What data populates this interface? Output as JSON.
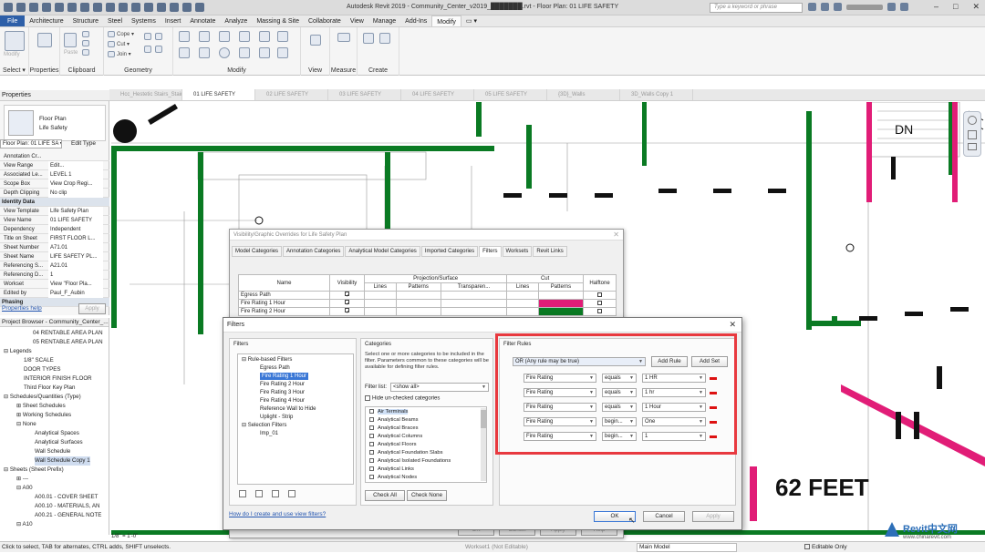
{
  "titlebar": {
    "title": "Autodesk Revit 2019 - Community_Center_v2019_███████.rvt - Floor Plan: 01 LIFE SAFETY",
    "search_placeholder": "Type a keyword or phrase",
    "window_controls": [
      "–",
      "□",
      "✕"
    ]
  },
  "tabs": [
    "File",
    "Architecture",
    "Structure",
    "Steel",
    "Systems",
    "Insert",
    "Annotate",
    "Analyze",
    "Massing & Site",
    "Collaborate",
    "View",
    "Manage",
    "Add-Ins",
    "Modify",
    "▭ ▾"
  ],
  "ribbon": {
    "modify_label": "Modify",
    "select_label": "Select ▾",
    "properties_label": "Properties",
    "clipboard_label": "Clipboard",
    "paste_label": "Paste",
    "cope": "Cope ▾",
    "cut": "Cut ▾",
    "join": "Join ▾",
    "geometry_label": "Geometry",
    "modify_group_label": "Modify",
    "view_label": "View",
    "measure_label": "Measure",
    "create_label": "Create"
  },
  "doc_tabs": [
    "Hcc_Hestetic Stairs_Stair...",
    "01 LIFE SAFETY",
    "02 LIFE SAFETY",
    "03 LIFE SAFETY",
    "04 LIFE SAFETY",
    "05 LIFE SAFETY",
    "{3D}_Walls",
    "3D_Walls Copy 1"
  ],
  "properties": {
    "title": "Properties",
    "type_line1": "Floor Plan",
    "type_line2": "Life Safety",
    "selector": "Floor Plan: 01 LIFE SA ▾",
    "edit_type": "Edit Type",
    "rows": [
      {
        "k": "Annotation Cr...",
        "v": ""
      },
      {
        "k": "View Range",
        "v": "Edit..."
      },
      {
        "k": "Associated Le...",
        "v": "LEVEL 1"
      },
      {
        "k": "Scope Box",
        "v": "View Crop Regi..."
      },
      {
        "k": "Depth Clipping",
        "v": "No clip"
      },
      {
        "k": "Identity Data",
        "v": "",
        "head": true
      },
      {
        "k": "View Template",
        "v": "Life Safety Plan"
      },
      {
        "k": "View Name",
        "v": "01 LIFE SAFETY"
      },
      {
        "k": "Dependency",
        "v": "Independent"
      },
      {
        "k": "Title on Sheet",
        "v": "FIRST FLOOR L..."
      },
      {
        "k": "Sheet Number",
        "v": "A71.01"
      },
      {
        "k": "Sheet Name",
        "v": "LIFE SAFETY PL..."
      },
      {
        "k": "Referencing S...",
        "v": "A21.01"
      },
      {
        "k": "Referencing D...",
        "v": "1"
      },
      {
        "k": "Workset",
        "v": "View \"Floor Pla..."
      },
      {
        "k": "Edited by",
        "v": "Paul_F_Aubin"
      },
      {
        "k": "Phasing",
        "v": "",
        "head": true
      }
    ],
    "help_link": "Properties help",
    "apply": "Apply"
  },
  "browser": {
    "title": "Project Browser - Community_Center_...",
    "items": [
      {
        "text": "04 RENTABLE AREA PLAN",
        "x": 36
      },
      {
        "text": "05 RENTABLE AREA PLAN",
        "x": 36
      },
      {
        "text": "⊟ Legends",
        "x": 4
      },
      {
        "text": "1/8\" SCALE",
        "x": 26
      },
      {
        "text": "DOOR TYPES",
        "x": 26
      },
      {
        "text": "INTERIOR FINISH FLOOR",
        "x": 26
      },
      {
        "text": "Third Floor Key Plan",
        "x": 26
      },
      {
        "text": "⊟ Schedules/Quantities (Type)",
        "x": 4
      },
      {
        "text": "⊞ Sheet Schedules",
        "x": 18
      },
      {
        "text": "⊞ Working Schedules",
        "x": 18
      },
      {
        "text": "⊟ None",
        "x": 18
      },
      {
        "text": "Analytical Spaces",
        "x": 38
      },
      {
        "text": "Analytical Surfaces",
        "x": 38
      },
      {
        "text": "Wall Schedule",
        "x": 38
      },
      {
        "text": "Wall Schedule Copy 1",
        "x": 38,
        "sel": true
      },
      {
        "text": "⊟ Sheets (Sheet Prefix)",
        "x": 4
      },
      {
        "text": "⊞ ---",
        "x": 18
      },
      {
        "text": "⊟ A00",
        "x": 18
      },
      {
        "text": "A00.01 - COVER SHEET",
        "x": 38
      },
      {
        "text": "A00.10 - MATERIALS, AN",
        "x": 38
      },
      {
        "text": "A00.21 - GENERAL NOTE",
        "x": 38
      },
      {
        "text": "⊟ A10",
        "x": 18
      }
    ]
  },
  "canvas": {
    "dn_label": "DN",
    "dim_label": "62 FEET"
  },
  "vg": {
    "title": "Visibility/Graphic Overrides for Life Safety Plan",
    "tabs": [
      "Model Categories",
      "Annotation Categories",
      "Analytical Model Categories",
      "Imported Categories",
      "Filters",
      "Worksets",
      "Revit Links"
    ],
    "col_name": "Name",
    "col_visibility": "Visibility",
    "col_projection": "Projection/Surface",
    "col_cut": "Cut",
    "col_halftone": "Halftone",
    "sub_lines": "Lines",
    "sub_patterns": "Patterns",
    "sub_transparency": "Transparen...",
    "sub_lines2": "Lines",
    "sub_patterns2": "Patterns",
    "rows": [
      "Egress Path",
      "Fire Rating 1 Hour",
      "Fire Rating 2 Hour"
    ]
  },
  "filters": {
    "title": "Filters",
    "filters_label": "Filters",
    "tree": [
      {
        "text": "⊟ Rule-based Filters",
        "x": 4
      },
      {
        "text": "Egress Path",
        "x": 24
      },
      {
        "text": "Fire Rating 1 Hour",
        "x": 24,
        "sel": true
      },
      {
        "text": "Fire Rating 2 Hour",
        "x": 24
      },
      {
        "text": "Fire Rating 3 Hour",
        "x": 24
      },
      {
        "text": "Fire Rating 4 Hour",
        "x": 24
      },
      {
        "text": "Reference Wall to Hide",
        "x": 24
      },
      {
        "text": "Uplight - Strip",
        "x": 24
      },
      {
        "text": "⊟ Selection Filters",
        "x": 4
      },
      {
        "text": "Imp_01",
        "x": 24
      }
    ],
    "categories_label": "Categories",
    "categories_desc": "Select one or more categories to be included in the filter. Parameters common to these categories will be available for defining filter rules.",
    "filter_list_label": "Filter list:",
    "filter_list_value": "<show all>",
    "hide_unchecked": "Hide un-checked categories",
    "categories": [
      "Air Terminals",
      "Analytical Beams",
      "Analytical Braces",
      "Analytical Columns",
      "Analytical Floors",
      "Analytical Foundation Slabs",
      "Analytical Isolated Foundations",
      "Analytical Links",
      "Analytical Nodes"
    ],
    "check_all": "Check All",
    "check_none": "Check None",
    "rules_label": "Filter Rules",
    "rules_mode": "OR (Any rule may be true)",
    "add_rule": "Add Rule",
    "add_set": "Add Set",
    "rules": [
      {
        "param": "Fire Rating",
        "op": "equals",
        "value": "1  HR"
      },
      {
        "param": "Fire Rating",
        "op": "equals",
        "value": "1  hr"
      },
      {
        "param": "Fire Rating",
        "op": "equals",
        "value": "1  Hour"
      },
      {
        "param": "Fire Rating",
        "op": "begin...",
        "value": "One"
      },
      {
        "param": "Fire Rating",
        "op": "begin...",
        "value": "1"
      }
    ],
    "help_link": "How do I create and use view filters?",
    "ok": "OK",
    "cancel": "Cancel",
    "apply": "Apply"
  },
  "bottom_buttons": {
    "ok": "OK",
    "cancel": "Cancel",
    "apply": "Apply",
    "help": "Help"
  },
  "view_control": {
    "scale": "1/8\" = 1'-0\""
  },
  "statusbar": {
    "hint": "Click to select, TAB for alternates, CTRL adds, SHIFT unselects.",
    "workset": "Workset1 (Not Editable)",
    "model": "Main Model",
    "editable_only": "Editable Only"
  },
  "watermark": {
    "brand": "Revit中文网",
    "url": "www.chinarevit.com"
  },
  "colors": {
    "wall_green": "#0a7a23",
    "highlight_red": "#e8393f",
    "accent_pink": "#e11d77",
    "file_tab": "#2d5fa8"
  }
}
